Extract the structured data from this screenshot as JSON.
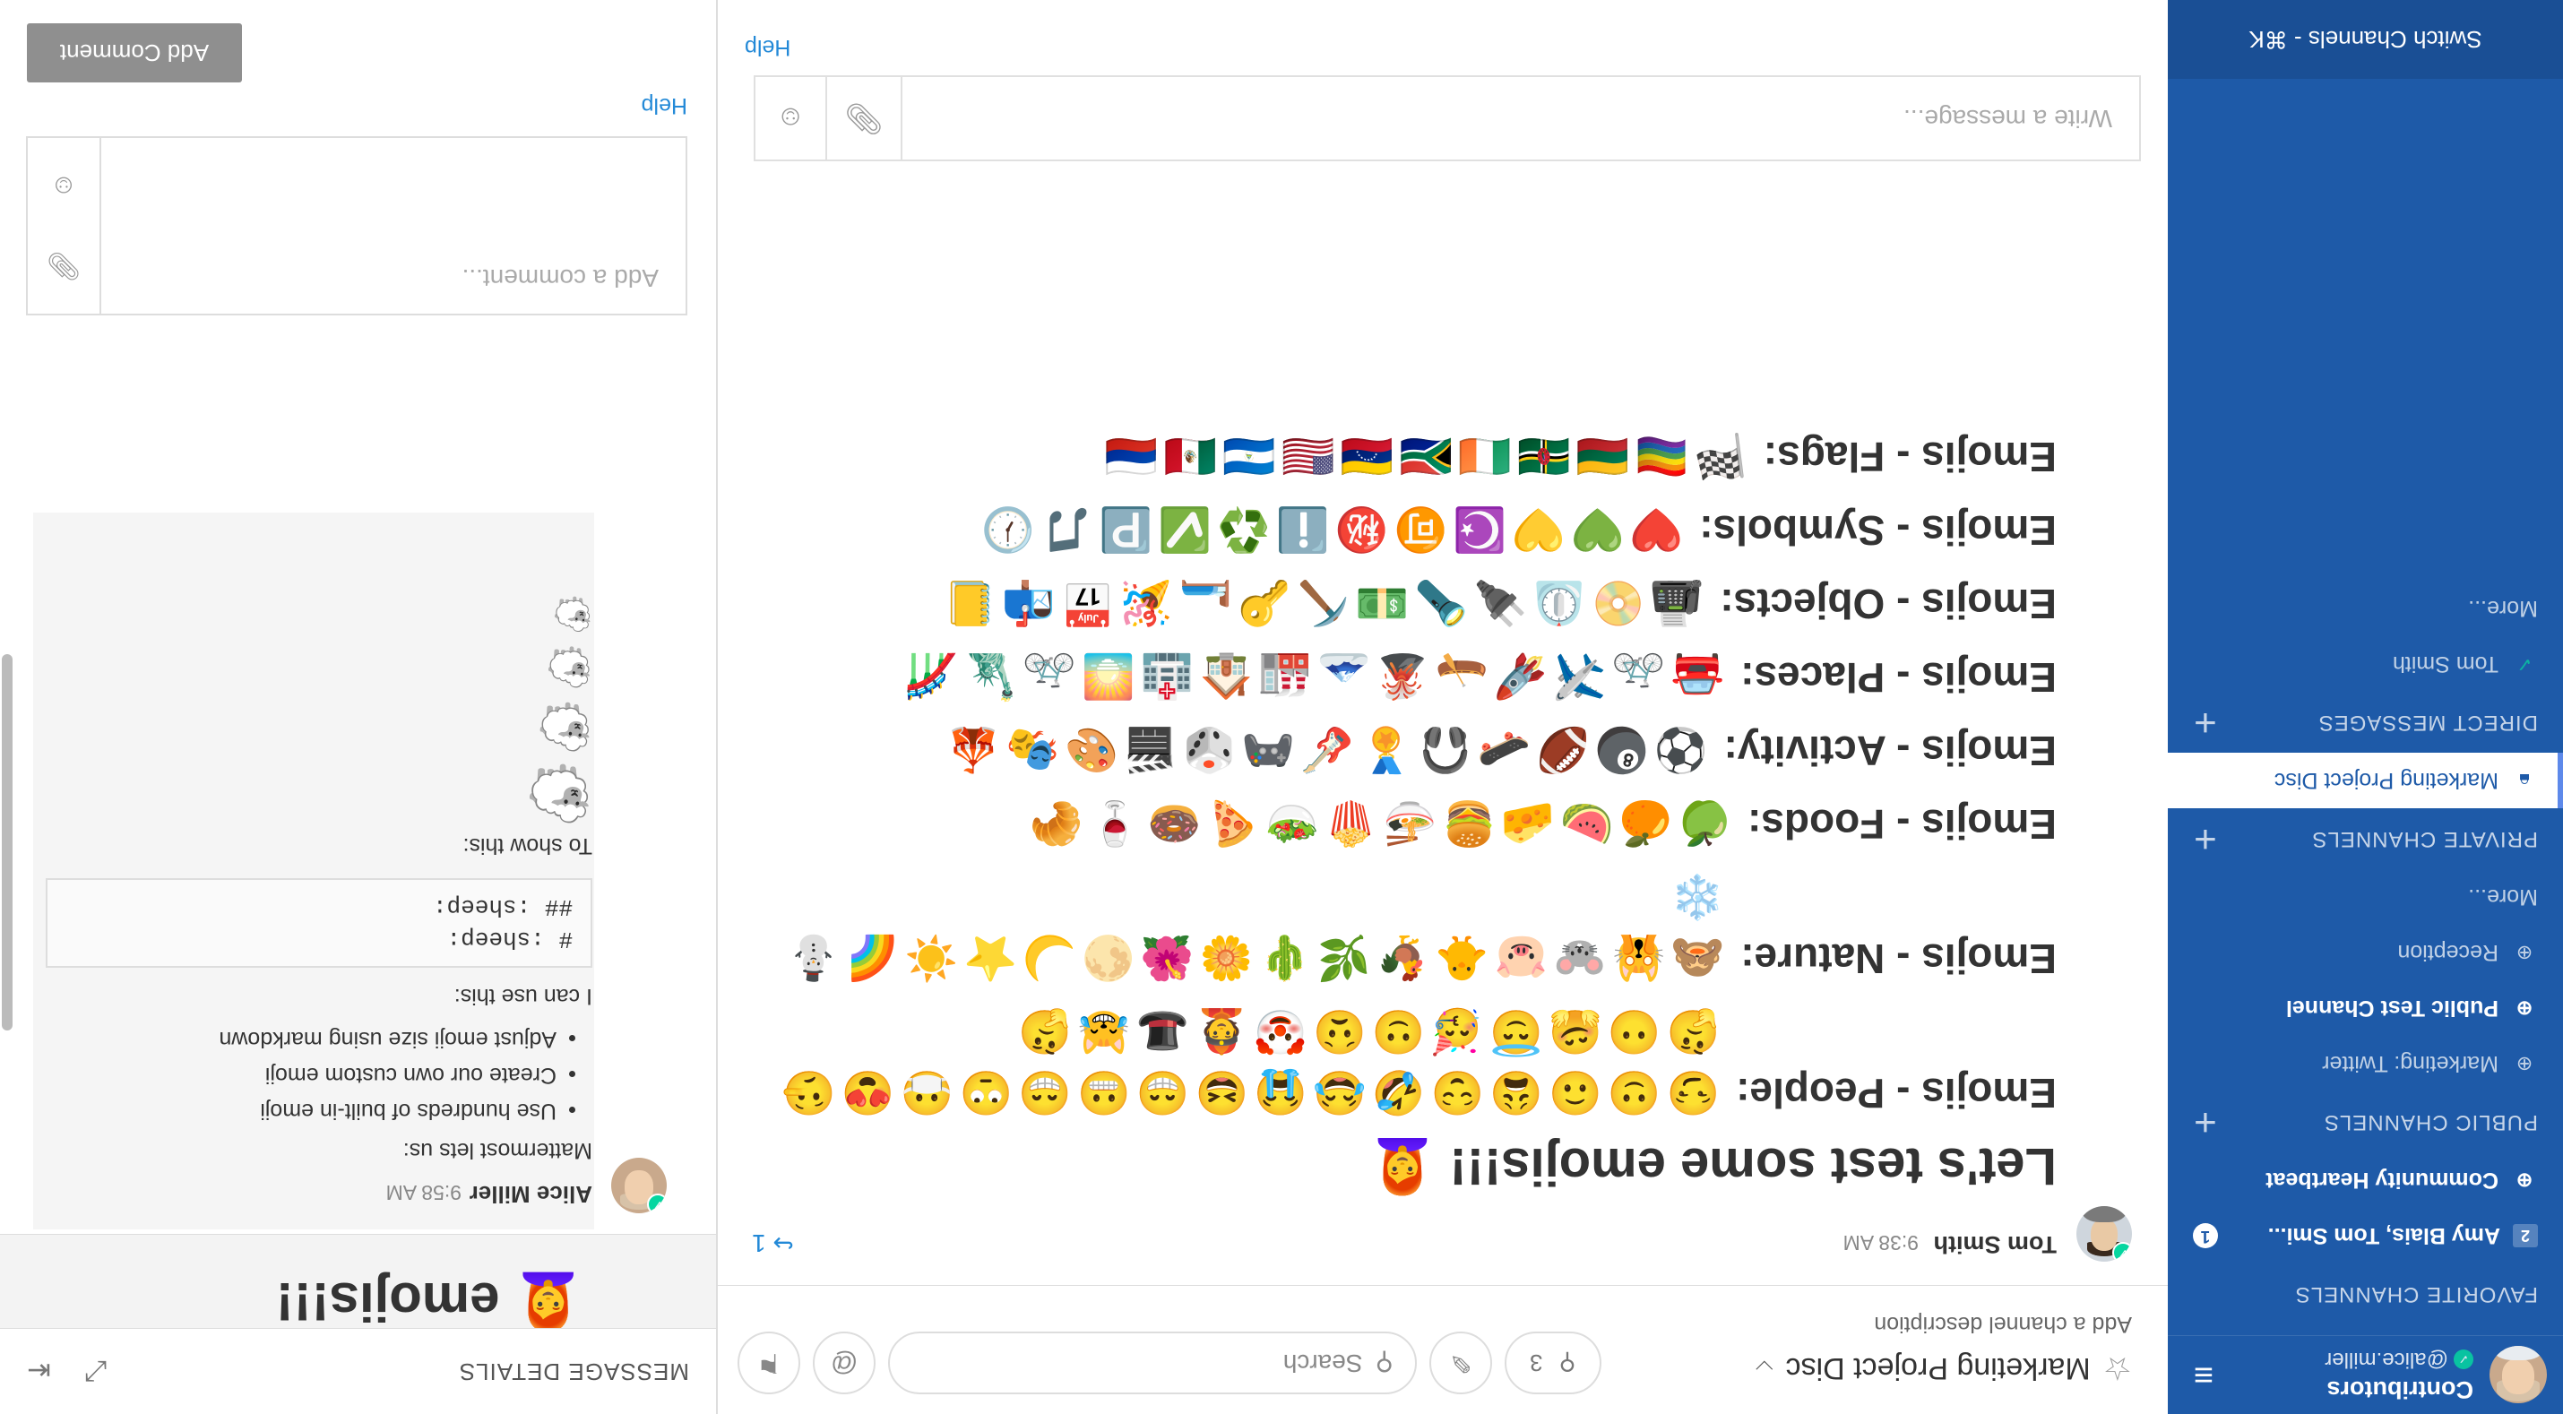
{
  "team": {
    "name": "Contributors",
    "user": "@alice.miller",
    "menu_icon": "hamburger-icon"
  },
  "sidebar": {
    "favorite_title": "FAVORITE CHANNELS",
    "favorites": [
      {
        "label": "Amy Blais, Tom Smi...",
        "badge": "2",
        "mention": "1"
      },
      {
        "label": "Community Heartbeat"
      }
    ],
    "public_title": "PUBLIC CHANNELS",
    "public": [
      {
        "label": "Marketing: Twitter"
      },
      {
        "label": "Public Test Channel"
      },
      {
        "label": "Reception"
      },
      {
        "label": "More..."
      }
    ],
    "private_title": "PRIVATE CHANNELS",
    "private": [
      {
        "label": "Marketing Project Disc"
      }
    ],
    "direct_title": "DIRECT MESSAGES",
    "direct": [
      {
        "label": "Tom Smith"
      },
      {
        "label": "More..."
      }
    ],
    "switch": "Switch Channels - ⌘K",
    "accent": "#1e5aa8"
  },
  "header": {
    "channel": "Marketing Project Disc",
    "description": "Add a channel description",
    "members": "3",
    "search_placeholder": "Search"
  },
  "post": {
    "author": "Tom Smith",
    "time": "9:38 AM",
    "reply_count": "1",
    "title": "Let's test some emojis!!!",
    "title_emoji": "👩‍🦰",
    "rows": [
      {
        "label": "Emojis - People:",
        "emojis": "😏🙂🙃😩😌🤣😂😭😆😁😬😁🙄😷😍🤥🤔😶🤗😇🥳🙂😟🤡👲🎩😹🤔"
      },
      {
        "label": "Emojis - Nature:",
        "emojis": "🙈🙀🐭🐷🐥🐓🌿🌵🌼🌺🌕🌙⭐☀️🌈⛄❄️"
      },
      {
        "label": "Emojis - Foods:",
        "emojis": "🍏🍊🍉🧀🍔🍜🍿🥗🍕🍩🍷🥐"
      },
      {
        "label": "Emojis - Activity:",
        "emojis": "⚽🎱🏈🛹🎧🏅🎸🎮🎲🎬🎨🎭🎪"
      },
      {
        "label": "Emojis - Places:",
        "emojis": "🚘🚲✈️🚀🛶🌋🗻🏭🏠🏥🌅🚲🗽🎢"
      },
      {
        "label": "Emojis - Objects:",
        "emojis": "📠📀⏲️🔌🔦💵⛏️🔑🛏️🎉📅📬📒"
      },
      {
        "label": "Emojis - Symbols:",
        "emojis": "❤️💚💛☪️🉑㊙️ℹ️♻️✅🅿️🎵🕖"
      },
      {
        "label": "Emojis - Flags:",
        "emojis": "🏁🏳️‍🌈🇱🇹🇩🇲🇮🇪🇿🇦🇻🇪🇺🇸🇳🇮🇲🇽🇷🇺"
      }
    ]
  },
  "composer": {
    "placeholder": "Write a message...",
    "help": "Help"
  },
  "rhs": {
    "title": "MESSAGE DETAILS",
    "root_text": "emojis!!!",
    "root_emoji": "👩‍🦰",
    "comment": {
      "author": "Alice Miller",
      "time": "9:58 AM",
      "intro": "Mattermost lets us:",
      "bullets": [
        "Use hundreds of built-in emoji",
        "Create our own custom emoji",
        "Adjust emoji size using markdown"
      ],
      "can_use": "I can use this:",
      "code": "# :sheep:\n## :sheep:",
      "to_show": "To show this:",
      "sheep": "🐑"
    },
    "input_placeholder": "Add a comment...",
    "help": "Help",
    "add_button": "Add Comment"
  }
}
